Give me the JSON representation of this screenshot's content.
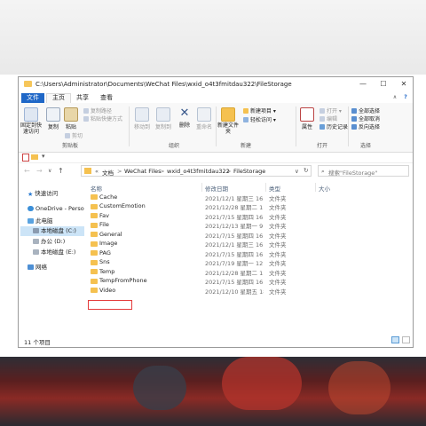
{
  "window": {
    "title": "C:\\Users\\Administrator\\Documents\\WeChat Files\\wxid_o4t3fmitdau322\\FileStorage",
    "min": "—",
    "max": "☐",
    "close": "✕"
  },
  "tabs": {
    "file": "文件",
    "home": "主页",
    "share": "共享",
    "view": "查看"
  },
  "ribbon": {
    "pin": "固定到快速访问",
    "copy": "复制",
    "paste": "粘贴",
    "copy_path": "复制路径",
    "paste_shortcut": "粘贴快捷方式",
    "cut": "剪切",
    "move_to": "移动到",
    "copy_to": "复制到",
    "delete": "删除",
    "rename": "重命名",
    "new_folder": "新建文件夹",
    "new_item": "新建项目 ▾",
    "easy_access": "轻松访问 ▾",
    "properties": "属性",
    "open": "打开 ▾",
    "edit": "编辑",
    "history": "历史记录",
    "select_all": "全部选择",
    "select_none": "全部取消",
    "invert": "反向选择",
    "groups": {
      "clipboard": "剪贴板",
      "organize": "组织",
      "new": "新建",
      "open": "打开",
      "select": "选择"
    }
  },
  "qat": {
    "arrow": "▾"
  },
  "address": {
    "back": "←",
    "forward": "→",
    "dropdown": "∨",
    "up": "↑",
    "sep": ">",
    "crumb_root": "«",
    "crumbs": [
      "文档",
      "WeChat Files",
      "wxid_o4t3fmitdau322",
      "FileStorage"
    ],
    "refresh": "↻",
    "search_placeholder": "搜索\"FileStorage\""
  },
  "nav": {
    "quick": "快速访问",
    "onedrive": "OneDrive - Perso",
    "thispc": "此电脑",
    "c": "本地磁盘 (C:)",
    "d": "办公 (D:)",
    "e": "本地磁盘 (E:)",
    "network": "网络"
  },
  "columns": {
    "name": "名称",
    "date": "修改日期",
    "type": "类型",
    "size": "大小"
  },
  "files": [
    {
      "name": "Cache",
      "date": "2021/12/1 星期三 16:...",
      "type": "文件夹"
    },
    {
      "name": "CustomEmotion",
      "date": "2021/12/28 星期二 1...",
      "type": "文件夹"
    },
    {
      "name": "Fav",
      "date": "2021/7/15 星期四 16:...",
      "type": "文件夹"
    },
    {
      "name": "File",
      "date": "2021/12/13 星期一 9:...",
      "type": "文件夹"
    },
    {
      "name": "General",
      "date": "2021/7/15 星期四 16:...",
      "type": "文件夹"
    },
    {
      "name": "Image",
      "date": "2021/12/1 星期三 16:...",
      "type": "文件夹"
    },
    {
      "name": "PAG",
      "date": "2021/7/15 星期四 16:...",
      "type": "文件夹"
    },
    {
      "name": "Sns",
      "date": "2021/7/19 星期一 12:...",
      "type": "文件夹"
    },
    {
      "name": "Temp",
      "date": "2021/12/28 星期二 1...",
      "type": "文件夹"
    },
    {
      "name": "TempFromPhone",
      "date": "2021/7/15 星期四 16:...",
      "type": "文件夹"
    },
    {
      "name": "Video",
      "date": "2021/12/10 星期五 18:...",
      "type": "文件夹"
    }
  ],
  "status": {
    "count": "11 个项目"
  },
  "colors": {
    "accent": "#1f67c7",
    "folder": "#f5c150",
    "highlight": "#e43b3b",
    "selected": "#cce4f7"
  }
}
